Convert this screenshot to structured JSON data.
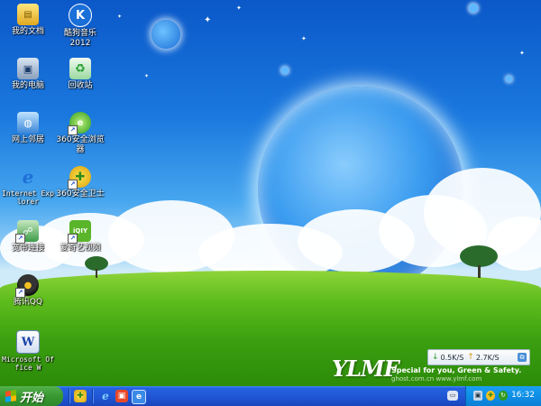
{
  "desktop": {
    "icons": [
      {
        "label": "我的文档"
      },
      {
        "label": "酷狗音乐\n2012"
      },
      {
        "label": "我的电脑"
      },
      {
        "label": "回收站"
      },
      {
        "label": "网上邻居"
      },
      {
        "label": "360安全浏览器"
      },
      {
        "label": "Internet Explorer"
      },
      {
        "label": "360安全卫士"
      },
      {
        "label": "宽带连接"
      },
      {
        "label": "爱奇艺视频"
      },
      {
        "label": "腾讯QQ"
      },
      {
        "label": "Microsoft Office W"
      }
    ],
    "icon_glyphs": {
      "kugou": "K",
      "iqiyi": "iQIY",
      "word": "W"
    }
  },
  "watermark": {
    "brand": "YLMF",
    "slogan": "Special for you, Green & Safety.",
    "slogan_small": "ghost.com.cn  www.ylmf.com"
  },
  "netwidget": {
    "download": "0.5K/S",
    "upload": "2.7K/S"
  },
  "taskbar": {
    "start_label": "开始",
    "clock": "16:32"
  },
  "colors": {
    "taskbar_blue": "#2563e0",
    "start_green": "#3a9a33",
    "tray_blue": "#0f8ee6"
  }
}
